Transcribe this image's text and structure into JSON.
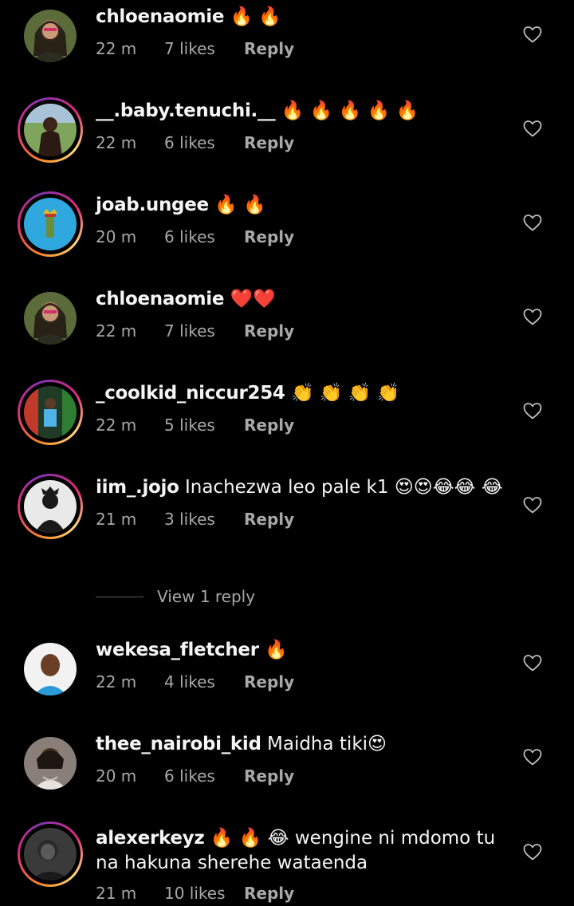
{
  "comments": [
    {
      "username": "chloenaomie",
      "text": "",
      "emoji": "🔥 🔥",
      "text2": "",
      "time": "22 m",
      "likes": "7 likes",
      "reply": "Reply"
    },
    {
      "username": "__.baby.tenuchi.__",
      "text": "",
      "emoji": "🔥 🔥 🔥 🔥 🔥",
      "text2": "",
      "time": "22 m",
      "likes": "6 likes",
      "reply": "Reply"
    },
    {
      "username": "joab.ungee",
      "text": "",
      "emoji": "🔥 🔥",
      "text2": "",
      "time": "20 m",
      "likes": "6 likes",
      "reply": "Reply"
    },
    {
      "username": "chloenaomie",
      "text": "",
      "emoji": "❤️❤️",
      "text2": "",
      "time": "22 m",
      "likes": "7 likes",
      "reply": "Reply"
    },
    {
      "username": "_coolkid_niccur254",
      "text": "",
      "emoji": "👏 👏 👏 👏",
      "text2": "",
      "time": "22 m",
      "likes": "5 likes",
      "reply": "Reply"
    },
    {
      "username": "iim_.jojo",
      "text": "Inachezwa leo pale k1",
      "emoji": "😍😍😂😂 😂",
      "text2": "",
      "time": "21 m",
      "likes": "3 likes",
      "reply": "Reply"
    },
    {
      "username": "wekesa_fletcher",
      "text": "",
      "emoji": "🔥",
      "text2": "",
      "time": "22 m",
      "likes": "4 likes",
      "reply": "Reply"
    },
    {
      "username": "thee_nairobi_kid",
      "text": "Maidha tiki",
      "emoji": "😍",
      "text2": "",
      "time": "20 m",
      "likes": "6 likes",
      "reply": "Reply"
    },
    {
      "username": "alexerkeyz",
      "text": "",
      "emoji": "🔥 🔥 😂",
      "text2": "wengine ni mdomo tu na hakuna sherehe wataenda",
      "time": "21 m",
      "likes": "10 likes",
      "reply": "Reply"
    }
  ],
  "view_replies": "View 1 reply",
  "icons": {
    "like": "heart-outline-icon"
  },
  "colors": {
    "background": "#000000",
    "meta": "#a8a8a8",
    "text": "#f5f5f5"
  }
}
